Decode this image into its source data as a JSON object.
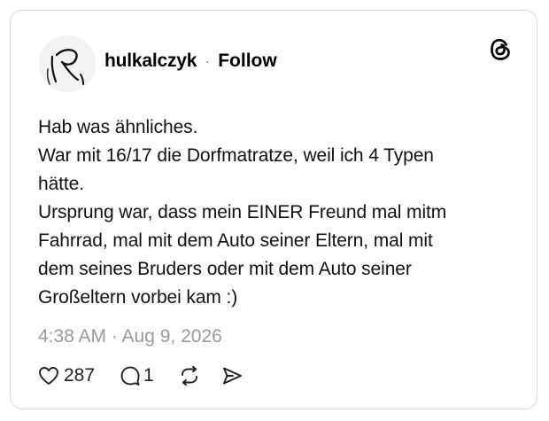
{
  "post": {
    "author": {
      "username": "hulkalczyk",
      "separator": "·",
      "follow_label": "Follow"
    },
    "body_lines": [
      "Hab was ähnliches.",
      "War mit 16/17 die Dorfmatratze, weil ich 4 Typen",
      "hätte.",
      "Ursprung war, dass mein EINER Freund mal mitm",
      "Fahrrad, mal mit dem Auto seiner Eltern, mal mit",
      "dem seines Bruders oder mit dem Auto seiner",
      "Großeltern vorbei kam :)"
    ],
    "timestamp": "4:38 AM · Aug 9, 2026",
    "actions": {
      "like_count": "287",
      "reply_count": "1"
    }
  },
  "icons": {
    "brand": "threads-logo-icon",
    "like": "heart-icon",
    "reply": "comment-bubble-icon",
    "repost": "repost-icon",
    "share": "send-icon"
  },
  "colors": {
    "text": "#111111",
    "muted": "#9a9a9a",
    "border": "#d9d9d9"
  }
}
